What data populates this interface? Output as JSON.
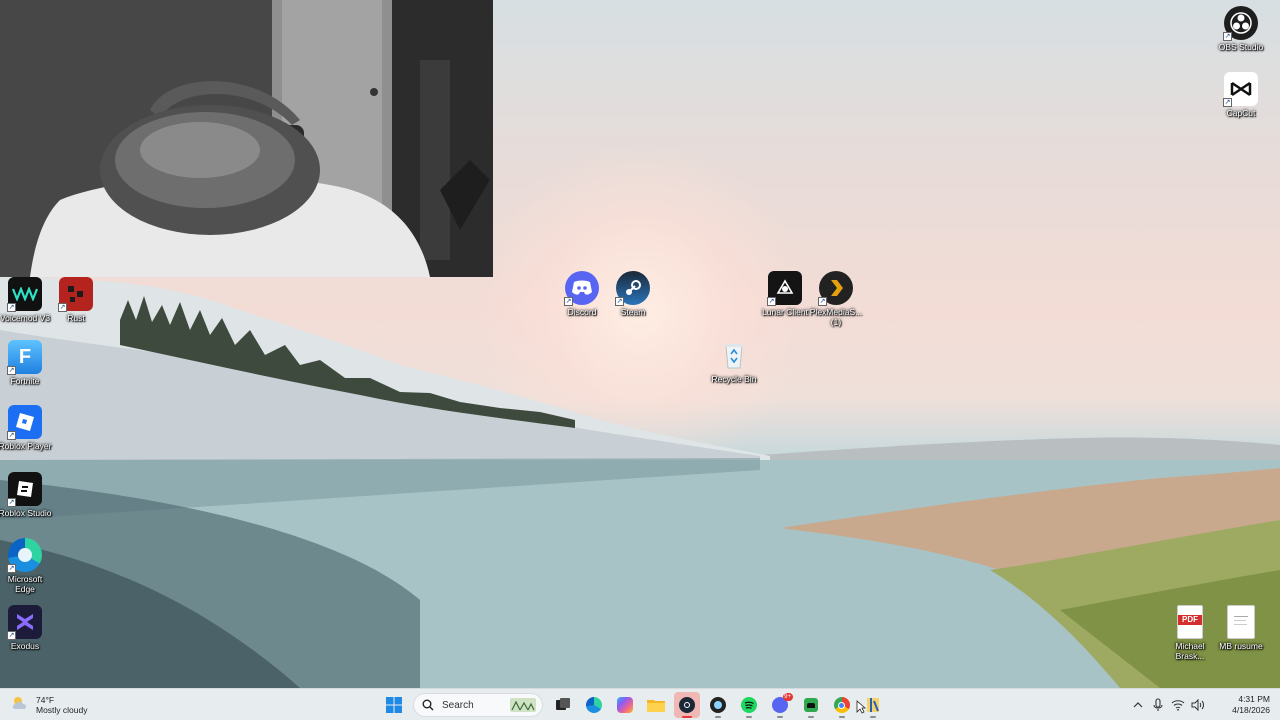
{
  "desktop": {
    "left_icons": [
      {
        "label": "Voicemod V3",
        "icon": "voicemod-icon"
      },
      {
        "label": "Rust",
        "icon": "rust-icon"
      },
      {
        "label": "Fortnite",
        "icon": "fortnite-icon"
      },
      {
        "label": "Roblox Player",
        "icon": "roblox-player-icon"
      },
      {
        "label": "Roblox Studio",
        "icon": "roblox-studio-icon"
      },
      {
        "label": "Microsoft Edge",
        "icon": "edge-icon"
      },
      {
        "label": "Exodus",
        "icon": "exodus-icon"
      }
    ],
    "center_icons": [
      {
        "label": "Discord",
        "icon": "discord-icon"
      },
      {
        "label": "Steam",
        "icon": "steam-icon"
      },
      {
        "label": "Lunar Client",
        "icon": "lunar-client-icon"
      },
      {
        "label": "PlexMediaS... (1)",
        "icon": "plex-icon"
      },
      {
        "label": "Recycle Bin",
        "icon": "recycle-bin-icon"
      }
    ],
    "right_icons": [
      {
        "label": "OBS Studio",
        "icon": "obs-icon"
      },
      {
        "label": "CapCut",
        "icon": "capcut-icon"
      },
      {
        "label": "Michael Brask...",
        "icon": "pdf-icon",
        "badge": "PDF"
      },
      {
        "label": "MB rusume",
        "icon": "document-icon"
      }
    ]
  },
  "taskbar": {
    "weather": {
      "temp": "74°F",
      "condition": "Mostly cloudy",
      "icon": "partly-cloudy-icon"
    },
    "search_placeholder": "Search",
    "apps": [
      "windows-start-icon",
      "search",
      "task-view-icon",
      "edge-icon",
      "copilot-icon",
      "file-explorer-icon",
      "steam-icon",
      "github-desktop-icon",
      "spotify-icon",
      "discord-icon",
      "android-icon",
      "chrome-icon",
      "file-archive-icon"
    ],
    "discord_badge": "9+",
    "tray": {
      "icons": [
        "show-hidden-icons-chevron",
        "microphone-icon",
        "wifi-icon",
        "volume-icon"
      ],
      "time": "4:31 PM",
      "date": "4/18/2026"
    },
    "colors": {
      "taskbar_bg": "#e7ecee",
      "active_app": "#f0b8b4"
    }
  }
}
